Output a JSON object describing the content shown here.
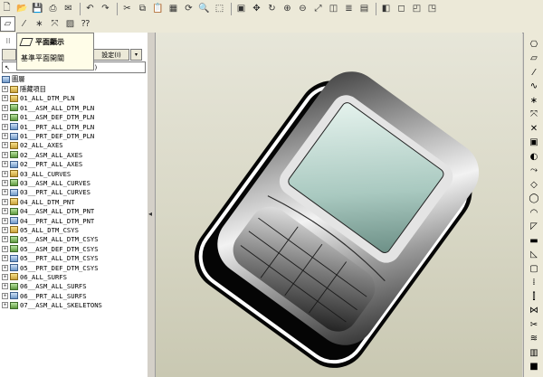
{
  "toolbar": {
    "row1_icons": [
      "new-icon",
      "open-icon",
      "save-icon",
      "print-icon",
      "email-icon",
      "undo-icon",
      "redo-icon",
      "cut-icon",
      "copy-icon",
      "paste-icon",
      "paste-special-icon",
      "regenerate-icon",
      "find-icon",
      "select-icon",
      "repaint-icon",
      "orient-icon",
      "spin-icon",
      "zoom-in-icon",
      "zoom-out-icon",
      "refit-icon",
      "saved-views-icon",
      "layers-icon",
      "model-display-icon",
      "shading-icon",
      "wireframe-icon",
      "hidden-line-icon",
      "no-hidden-icon"
    ],
    "row2_icons": [
      "datum-plane-icon",
      "datum-axis-icon",
      "datum-point-icon",
      "datum-csys-icon",
      "annotation-icon",
      "help-icon"
    ]
  },
  "tooltip": {
    "title": "平面顯示",
    "subtitle": "基準平面開關"
  },
  "panel": {
    "settings_label": "設定(I)",
    "mode_text": "層樹模型, 活動的)"
  },
  "tree": {
    "root": "圖層",
    "items": [
      {
        "label": "隱藏項目",
        "type": "folder"
      },
      {
        "label": "01_ALL_DTM_PLN",
        "type": "layer"
      },
      {
        "label": "01__ASM_ALL_DTM_PLN",
        "type": "layer"
      },
      {
        "label": "01__ASM_DEF_DTM_PLN",
        "type": "layer"
      },
      {
        "label": "01__PRT_ALL_DTM_PLN",
        "type": "layer"
      },
      {
        "label": "01__PRT_DEF_DTM_PLN",
        "type": "layer"
      },
      {
        "label": "02_ALL_AXES",
        "type": "layer"
      },
      {
        "label": "02__ASM_ALL_AXES",
        "type": "layer"
      },
      {
        "label": "02__PRT_ALL_AXES",
        "type": "layer"
      },
      {
        "label": "03_ALL_CURVES",
        "type": "layer"
      },
      {
        "label": "03__ASM_ALL_CURVES",
        "type": "layer"
      },
      {
        "label": "03__PRT_ALL_CURVES",
        "type": "layer"
      },
      {
        "label": "04_ALL_DTM_PNT",
        "type": "layer"
      },
      {
        "label": "04__ASM_ALL_DTM_PNT",
        "type": "layer"
      },
      {
        "label": "04__PRT_ALL_DTM_PNT",
        "type": "layer"
      },
      {
        "label": "05_ALL_DTM_CSYS",
        "type": "layer"
      },
      {
        "label": "05__ASM_ALL_DTM_CSYS",
        "type": "layer"
      },
      {
        "label": "05__ASM_DEF_DTM_CSYS",
        "type": "layer"
      },
      {
        "label": "05__PRT_ALL_DTM_CSYS",
        "type": "layer"
      },
      {
        "label": "05__PRT_DEF_DTM_CSYS",
        "type": "layer"
      },
      {
        "label": "06_ALL_SURFS",
        "type": "layer"
      },
      {
        "label": "06__ASM_ALL_SURFS",
        "type": "layer"
      },
      {
        "label": "06__PRT_ALL_SURFS",
        "type": "layer"
      },
      {
        "label": "07__ASM_ALL_SKELETONS",
        "type": "layer"
      }
    ]
  },
  "right_toolbar_icons": [
    "sketch-icon",
    "datum-plane-icon",
    "datum-axis-icon",
    "curve-icon",
    "point-icon",
    "csys-icon",
    "analysis-icon",
    "extrude-icon",
    "revolve-icon",
    "sweep-icon",
    "blend-icon",
    "hole-icon",
    "round-icon",
    "chamfer-icon",
    "rib-icon",
    "draft-icon",
    "shell-icon",
    "pattern-icon",
    "mirror-icon",
    "merge-icon",
    "trim-icon",
    "offset-icon",
    "thicken-icon",
    "solidify-icon"
  ]
}
